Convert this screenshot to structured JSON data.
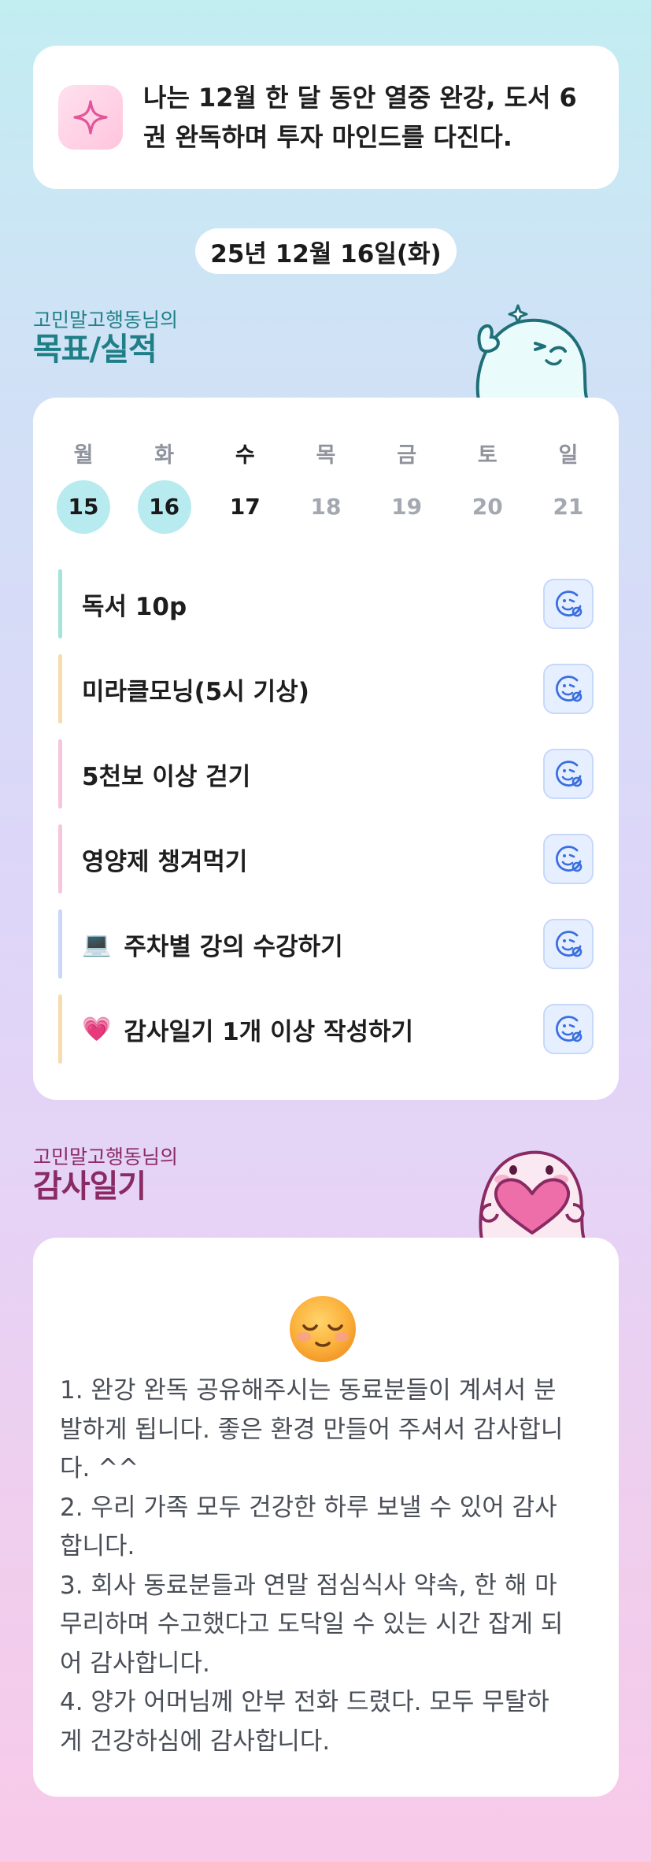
{
  "goal": {
    "icon": "sparkle-icon",
    "text": "나는 12월 한 달 동안 열중 완강, 도서 6권 완독하며 투자 마인드를 다진다."
  },
  "date_label": "25년 12월 16일(화)",
  "goals_section": {
    "subtitle": "고민말고행동님의",
    "title": "목표/실적"
  },
  "calendar": {
    "weekdays": [
      "월",
      "화",
      "수",
      "목",
      "금",
      "토",
      "일"
    ],
    "days": [
      "15",
      "16",
      "17",
      "18",
      "19",
      "20",
      "21"
    ],
    "completed_days": [
      "15",
      "16"
    ],
    "today": "17"
  },
  "tasks": [
    {
      "label": "독서 10p",
      "emoji": "",
      "bar_color": "#a6e3dc"
    },
    {
      "label": "미라클모닝(5시 기상)",
      "emoji": "",
      "bar_color": "#f7dcae"
    },
    {
      "label": "5천보 이상 걷기",
      "emoji": "",
      "bar_color": "#f7c6dd"
    },
    {
      "label": "영양제 챙겨먹기",
      "emoji": "",
      "bar_color": "#f7c6dd"
    },
    {
      "label": "주차별 강의 수강하기",
      "emoji": "💻",
      "bar_color": "#c9d8f6"
    },
    {
      "label": "감사일기 1개 이상 작성하기",
      "emoji": "💗",
      "bar_color": "#f7dcae"
    }
  ],
  "task_check_icon": "smiley-check-icon",
  "gratitude_section": {
    "subtitle": "고민말고행동님의",
    "title": "감사일기"
  },
  "gratitude": {
    "mood_emoji": "relieved-face-emoji",
    "text": "1. 완강 완독 공유해주시는 동료분들이 계셔서 분\n발하게 됩니다. 좋은 환경 만들어 주셔서 감사합니\n다. ^^\n2. 우리 가족 모두 건강한 하루 보낼 수 있어 감사\n합니다.\n3. 회사 동료분들과 연말 점심식사 약속, 한 해 마\n무리하며 수고했다고 도닥일 수 있는 시간 잡게 되\n어 감사합니다.\n4. 양가 어머님께 안부 전화 드렸다. 모두 무탈하\n게 건강하심에 감사합니다."
  },
  "colors": {
    "teal": "#1e7f86",
    "plum": "#8a2a63",
    "done_day": "#b8ebef",
    "check_blue": "#3b6fe0"
  }
}
